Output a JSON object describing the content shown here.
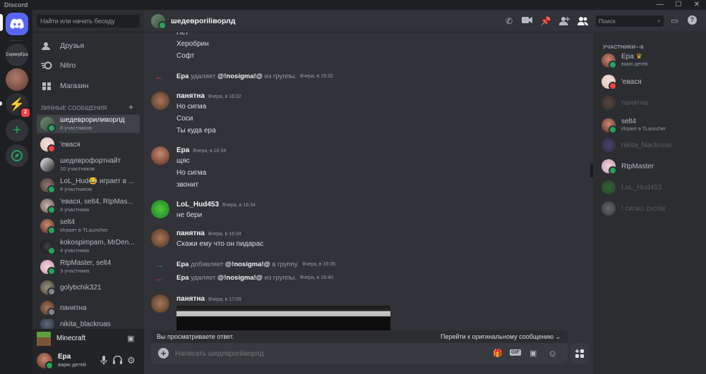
{
  "app_title": "Discord",
  "window_controls": {
    "minimize": "—",
    "maximize": "☐",
    "close": "✕"
  },
  "rail": {
    "servers": [
      {
        "name": "СерверЕра"
      }
    ],
    "badge": "2"
  },
  "sidebar": {
    "search_placeholder": "Найти или начать беседу",
    "nav": [
      {
        "label": "Друзья"
      },
      {
        "label": "Nitro"
      },
      {
        "label": "Магазин"
      }
    ],
    "dm_header": "ЛИЧНЫЕ СООБЩЕНИЯ",
    "dm_plus": "+",
    "dms": [
      {
        "name": "шедеврориливорлд",
        "sub": "8 участников"
      },
      {
        "name": "'евася",
        "sub": ""
      },
      {
        "name": "шедеврофортнайт",
        "sub": "10 участников"
      },
      {
        "name": "LoL_Hud😂 играет в ...",
        "sub": "8 участников"
      },
      {
        "name": "'евася, selt4, RtpMas...",
        "sub": "4 участника"
      },
      {
        "name": "selt4",
        "sub": "Играет в TLauncher"
      },
      {
        "name": "kokospimpam, MrDen...",
        "sub": "4 участника"
      },
      {
        "name": "RtpMaster, selt4",
        "sub": "3 участника"
      },
      {
        "name": "golybchik321",
        "sub": ""
      },
      {
        "name": "панятна",
        "sub": ""
      },
      {
        "name": "nikita_blackruas",
        "sub": ""
      }
    ],
    "game": "Minecraft",
    "user": {
      "name": "Ера",
      "status": "варю детей"
    }
  },
  "chat": {
    "title": "шедевроriliворлд",
    "composer_placeholder": "Написать шедевроriliворлд",
    "reply_text": "Вы просматриваете ответ.",
    "reply_jump": "Перейти к оригинальному сообщению",
    "messages": [
      {
        "lines": [
          "Нет",
          "Херобрин",
          "Софт"
        ]
      },
      {
        "system": true,
        "actor": "Ера",
        "action": "удаляет",
        "target": "@!nosigma!@",
        "rest": "из группы.",
        "time": "Вчера, в 16:32"
      },
      {
        "author": "панятна",
        "time": "Вчера, в 16:32",
        "lines": [
          "Но сигма",
          "Соси",
          "Ты куда ера"
        ]
      },
      {
        "author": "Ера",
        "time": "Вчера, в 16:34",
        "lines": [
          "щяс",
          "Но сигма",
          "звонит"
        ]
      },
      {
        "author": "LoL_Hud453",
        "time": "Вчера, в 16:34",
        "lines": [
          "не бери"
        ]
      },
      {
        "author": "панятна",
        "time": "Вчера, в 16:34",
        "lines": [
          "Скажи ему что он пидарас"
        ]
      },
      {
        "system": true,
        "actor": "Ера",
        "action": "добавляет",
        "target": "@!nosigma!@",
        "rest": "в группу.",
        "time": "Вчера, в 16:35"
      },
      {
        "system": true,
        "actor": "Ера",
        "action": "удаляет",
        "target": "@!nosigma!@",
        "rest": "из группы.",
        "time": "Вчера, в 16:40"
      },
      {
        "author": "панятна",
        "time": "Вчера, в 17:09",
        "lines": []
      }
    ]
  },
  "members": {
    "search_placeholder": "Поиск",
    "header": "УЧАСТНИКИ—8",
    "list": [
      {
        "name": "Ера",
        "sub": "варю детей"
      },
      {
        "name": "'евася",
        "sub": ""
      },
      {
        "name": "панятна",
        "sub": ""
      },
      {
        "name": "selt4",
        "sub": "Играет в TLauncher"
      },
      {
        "name": "nikita_blackruas",
        "sub": ""
      },
      {
        "name": "RtpMaster",
        "sub": ""
      },
      {
        "name": "LoL_Hud453",
        "sub": ""
      },
      {
        "name": "! сигмо zxcnlx",
        "sub": ""
      }
    ]
  },
  "colors": {
    "blurple": "#5865f2",
    "green": "#23a559",
    "red": "#f23f43",
    "idle": "#f0b232"
  }
}
